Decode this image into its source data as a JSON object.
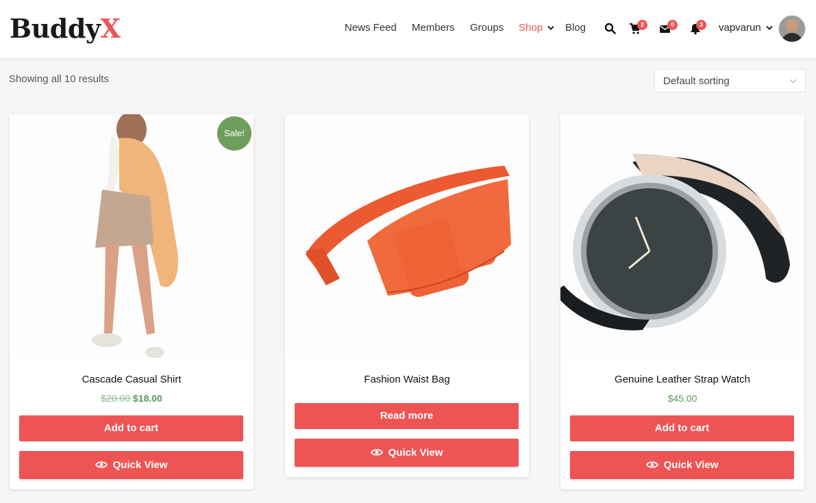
{
  "logo": {
    "part1": "Buddy",
    "part2": "X"
  },
  "nav": {
    "items": [
      {
        "label": "News Feed"
      },
      {
        "label": "Members"
      },
      {
        "label": "Groups"
      },
      {
        "label": "Shop",
        "active": true
      },
      {
        "label": "Blog"
      }
    ],
    "cart_count": "2",
    "messages_count": "0",
    "notifications_count": "3",
    "username": "vapvarun"
  },
  "toolbar": {
    "result_count": "Showing all 10 results",
    "sort_selected": "Default sorting"
  },
  "products": [
    {
      "title": "Cascade Casual Shirt",
      "old_price": "$20.00",
      "price": "$18.00",
      "badge": "Sale!",
      "primary_button": "Add to cart",
      "secondary_button": "Quick View",
      "image": "woman-jacket-photo"
    },
    {
      "title": "Fashion Waist Bag",
      "price": "",
      "primary_button": "Read more",
      "secondary_button": "Quick View",
      "image": "orange-waist-bag-photo"
    },
    {
      "title": "Genuine Leather Strap Watch",
      "price": "$45.00",
      "primary_button": "Add to cart",
      "secondary_button": "Quick View",
      "image": "leather-watch-photo"
    }
  ],
  "colors": {
    "accent": "#ef5455",
    "sale": "#6f9d5e",
    "price": "#5b9a5b"
  }
}
